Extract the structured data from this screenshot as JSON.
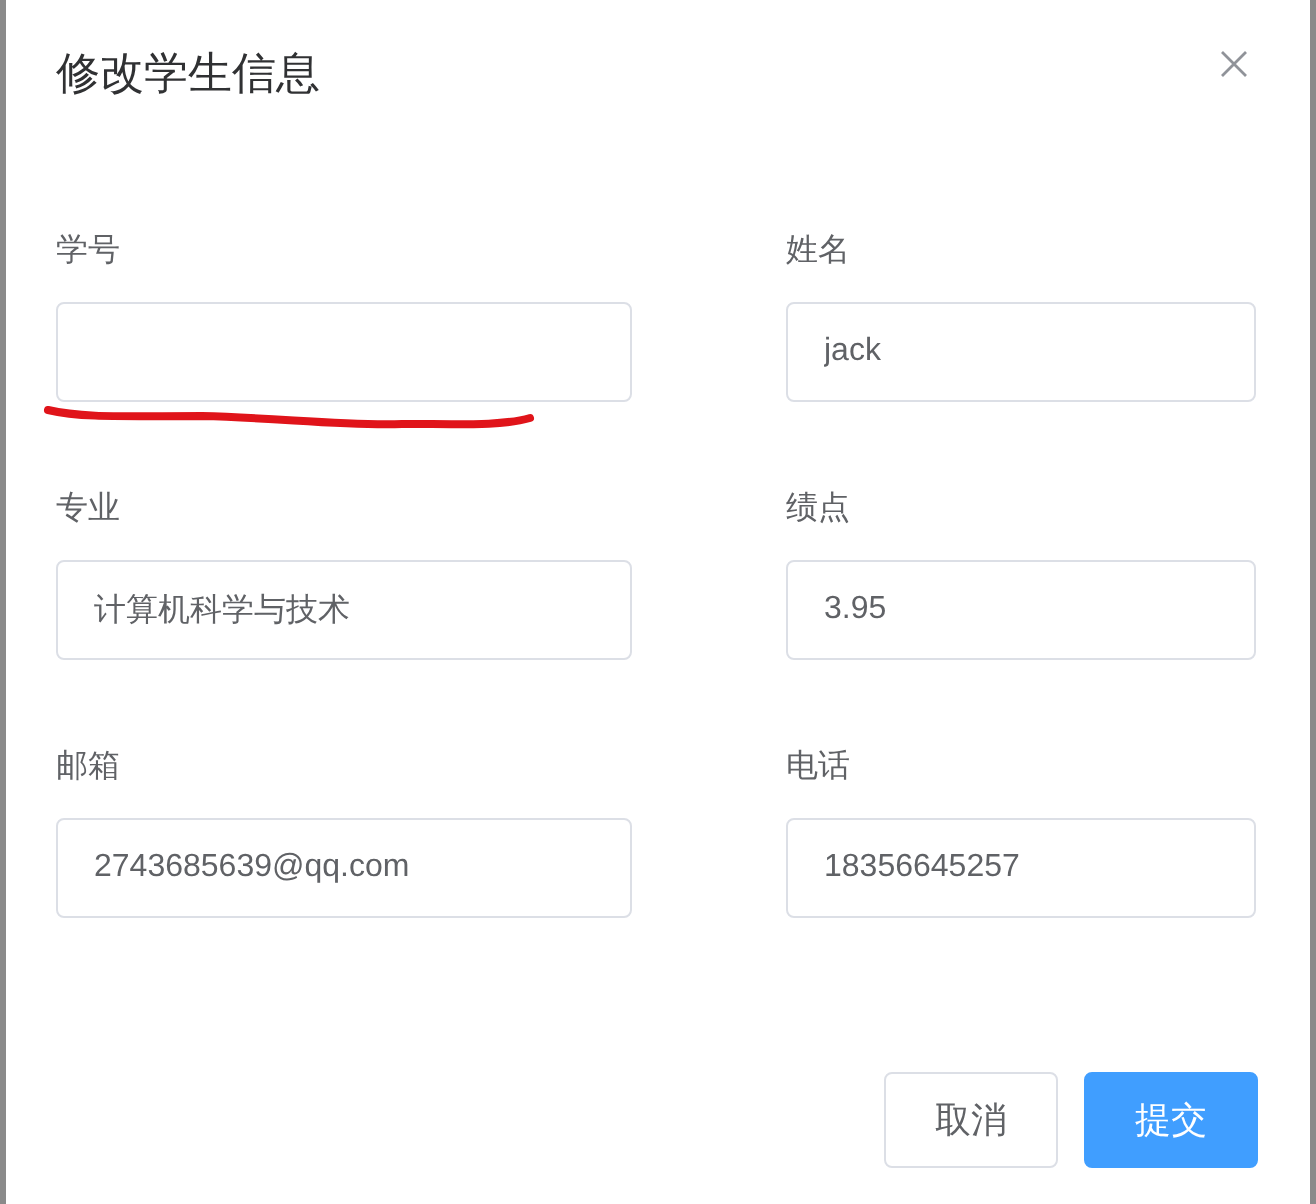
{
  "dialog": {
    "title": "修改学生信息"
  },
  "fields": [
    {
      "label": "学号"
    },
    {
      "label": "姓名",
      "value": "jack"
    },
    {
      "label": "专业",
      "value": "计算机科学与技术"
    },
    {
      "label": "绩点",
      "value": "3.95"
    },
    {
      "label": "邮箱",
      "value": "2743685639@qq.com"
    },
    {
      "label": "电话",
      "value": "18356645257"
    }
  ],
  "buttons": [
    {
      "label": "取消",
      "kind": "default"
    },
    {
      "label": "提交",
      "kind": "primary"
    }
  ]
}
